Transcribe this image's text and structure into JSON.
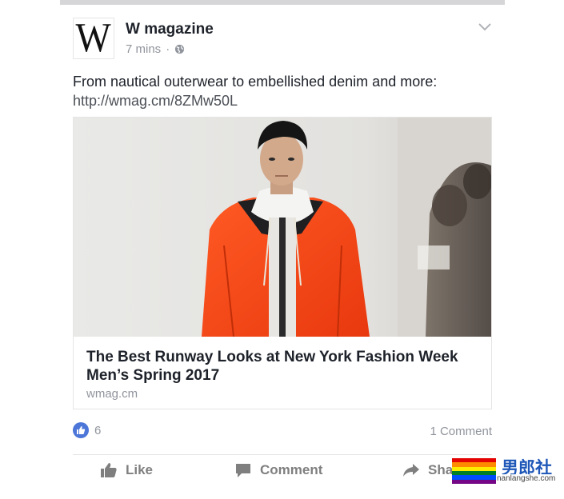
{
  "post": {
    "avatar_letter": "W",
    "page_name": "W magazine",
    "time": "7 mins",
    "separator": "·",
    "privacy_icon": "globe-icon",
    "text": "From nautical outerwear to embellished denim and more:",
    "link": "http://wmag.cm/8ZMw50L",
    "menu_icon": "chevron-down-icon"
  },
  "preview": {
    "title": "The Best Runway Looks at New York Fashion Week Men’s Spring 2017",
    "domain": "wmag.cm"
  },
  "stats": {
    "like_count": "6",
    "comment_count": "1 Comment"
  },
  "actions": {
    "like": "Like",
    "comment": "Comment",
    "share": "Sha"
  },
  "watermark": {
    "text": "男郎社",
    "sub": "nanlangshe.com"
  },
  "colors": {
    "like_blue": "#4c76d7",
    "jacket_orange": "#ff4a1c",
    "muted_text": "#90949c"
  }
}
